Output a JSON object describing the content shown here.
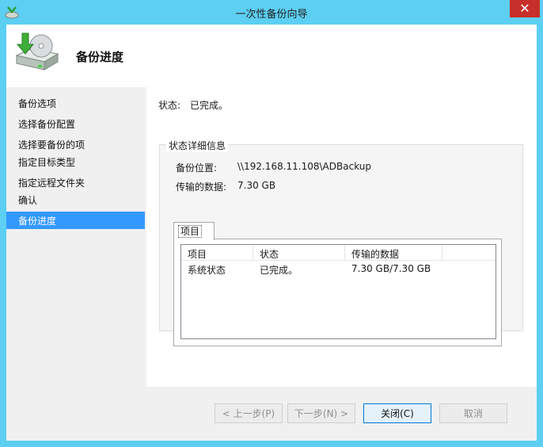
{
  "window": {
    "title": "一次性备份向导",
    "close_glyph": "✕"
  },
  "header": {
    "title": "备份进度",
    "icon": "backup-disk-icon"
  },
  "sidebar": {
    "items": [
      {
        "label": "备份选项",
        "active": false
      },
      {
        "label": "选择备份配置",
        "active": false
      },
      {
        "label": "选择要备份的项",
        "active": false
      },
      {
        "label": "指定目标类型",
        "active": false
      },
      {
        "label": "指定远程文件夹",
        "active": false
      },
      {
        "label": "确认",
        "active": false
      },
      {
        "label": "备份进度",
        "active": true
      }
    ]
  },
  "main": {
    "status_label": "状态:",
    "status_value": "已完成。",
    "details": {
      "legend": "状态详细信息",
      "location_label": "备份位置:",
      "location_value": "\\\\192.168.11.108\\ADBackup",
      "transferred_label": "传输的数据:",
      "transferred_value": "7.30 GB",
      "tab_label": "项目",
      "table": {
        "columns": [
          "项目",
          "状态",
          "传输的数据"
        ],
        "rows": [
          [
            "系统状态",
            "已完成。",
            "7.30 GB/7.30 GB"
          ]
        ]
      }
    }
  },
  "footer": {
    "prev_label": "< 上一步(P)",
    "next_label": "下一步(N) >",
    "close_label": "关闭(C)",
    "cancel_label": "取消"
  },
  "colors": {
    "titlebar": "#5ccff2",
    "selection": "#3399ff",
    "close": "#c7302a"
  }
}
